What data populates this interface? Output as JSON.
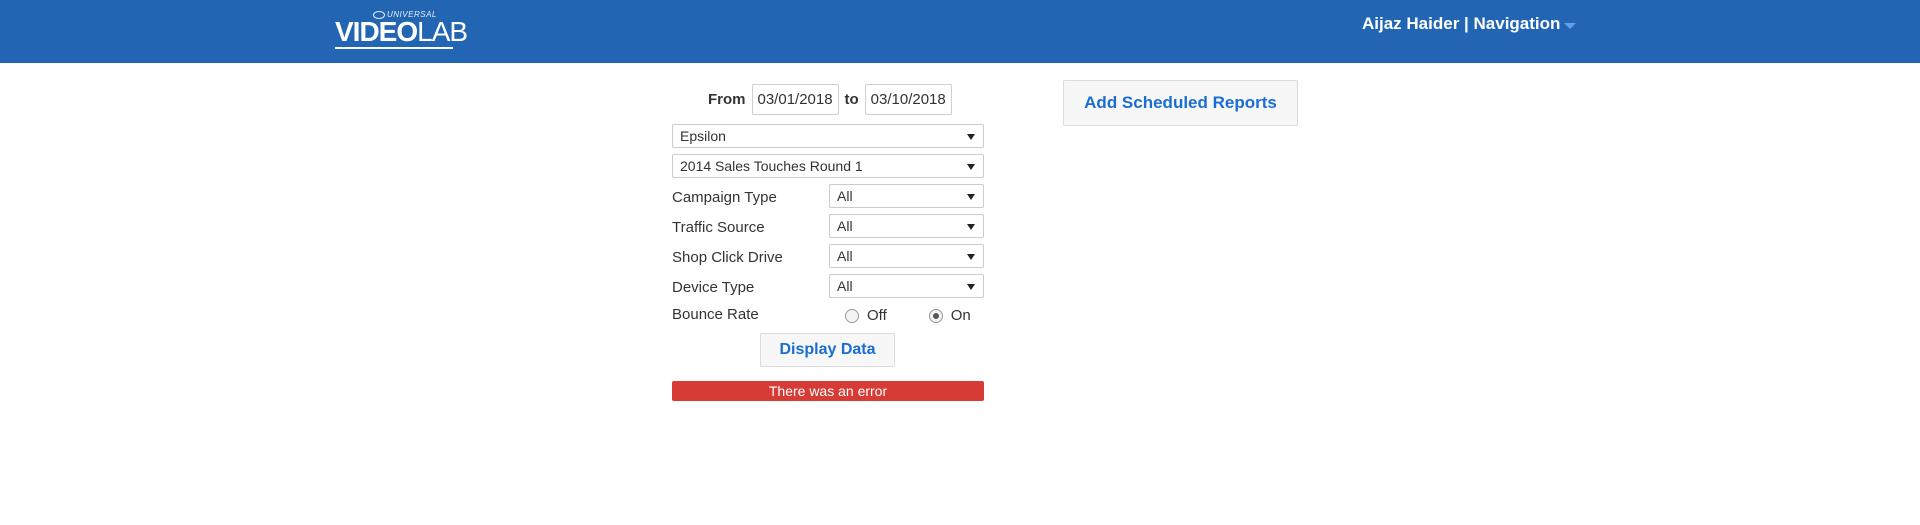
{
  "header": {
    "logo_tag": "UNIVERSAL",
    "logo_bold": "VIDEO",
    "logo_light": "LAB",
    "user_menu": "Aijaz Haider | Navigation"
  },
  "filters": {
    "from_label": "From",
    "from_date": "03/01/2018",
    "to_label": "to",
    "to_date": "03/10/2018",
    "account_select": "Epsilon",
    "campaign_select": "2014 Sales Touches Round 1",
    "rows": [
      {
        "label": "Campaign Type",
        "value": "All"
      },
      {
        "label": "Traffic Source",
        "value": "All"
      },
      {
        "label": "Shop Click Drive",
        "value": "All"
      },
      {
        "label": "Device Type",
        "value": "All"
      }
    ],
    "bounce_rate": {
      "label": "Bounce Rate",
      "off_label": "Off",
      "on_label": "On",
      "selected": "On"
    },
    "display_button": "Display Data",
    "error_message": "There was an error"
  },
  "actions": {
    "add_scheduled_reports": "Add Scheduled Reports"
  },
  "colors": {
    "header_bg": "#2266b3",
    "link_blue": "#1a6ed1",
    "error_red": "#d63b35"
  }
}
